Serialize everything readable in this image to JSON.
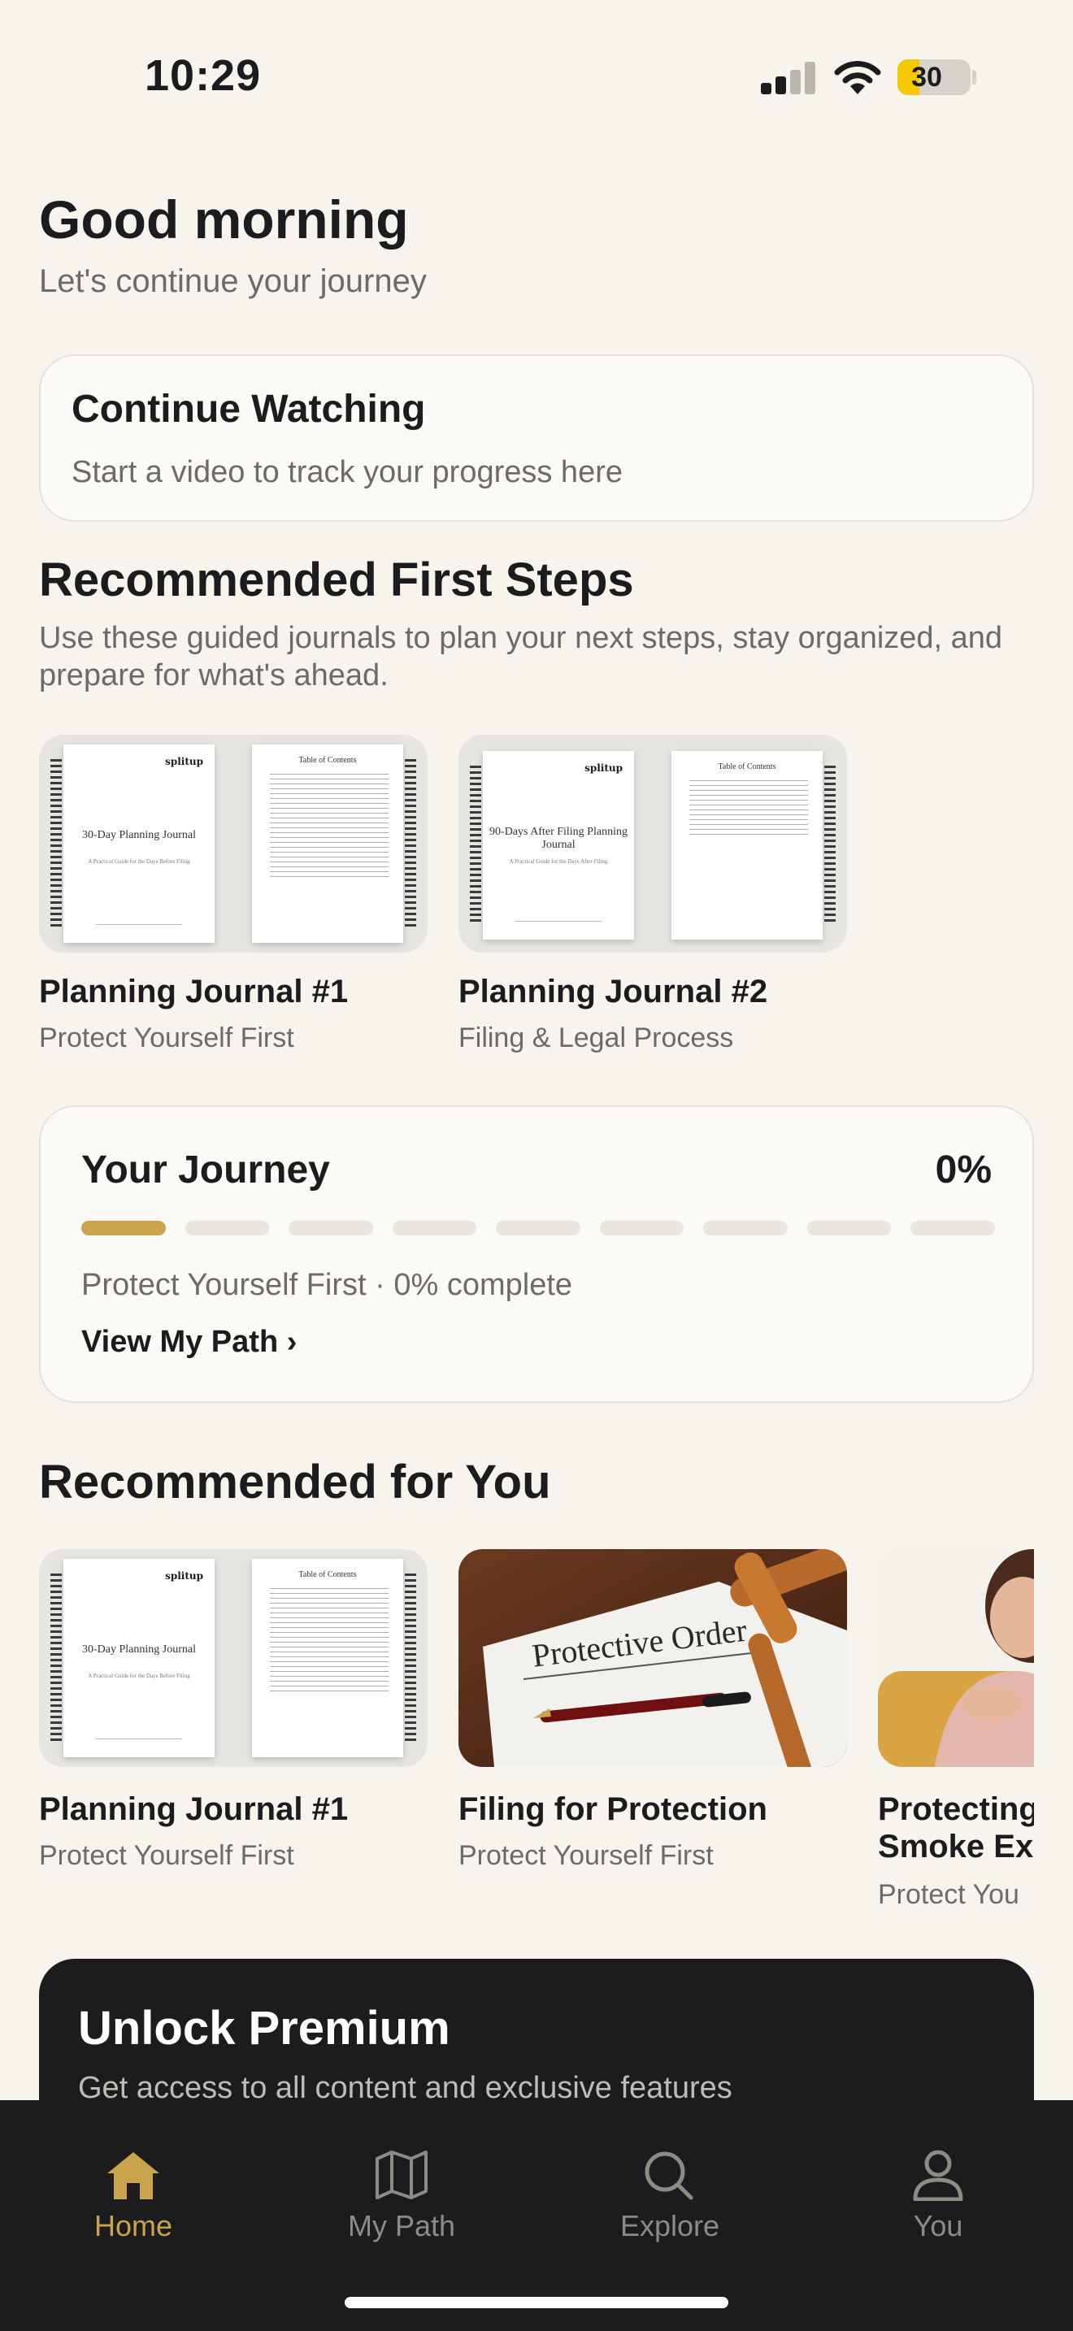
{
  "status_bar": {
    "time": "10:29",
    "battery": "30",
    "battery_level": 0.3
  },
  "greeting": {
    "title": "Good morning",
    "subtitle": "Let's continue your journey"
  },
  "continue_watching": {
    "title": "Continue Watching",
    "subtitle": "Start a video to track your progress here"
  },
  "first_steps": {
    "title": "Recommended First Steps",
    "description": "Use these guided journals to plan your next steps, stay organized, and prepare for what's ahead.",
    "items": [
      {
        "title": "Planning Journal #1",
        "subtitle": "Protect Yourself First",
        "cover_title": "30-Day Planning Journal",
        "cover_sub": "A Practical Guide for the Days Before Filing",
        "brand": "splitup",
        "toc_title": "Table of Contents"
      },
      {
        "title": "Planning Journal #2",
        "subtitle": "Filing & Legal Process",
        "cover_title": "90-Days After Filing Planning Journal",
        "cover_sub": "A Practical Guide for the Days After Filing",
        "brand": "splitup",
        "toc_title": "Table of Contents"
      }
    ]
  },
  "journey": {
    "title": "Your Journey",
    "percent": "0%",
    "progress": 0,
    "segments": 9,
    "status": "Protect Yourself First · 0% complete",
    "link": "View My Path ›",
    "accent": "#c9a44c"
  },
  "recommended": {
    "title": "Recommended for You",
    "items": [
      {
        "title": "Planning Journal #1",
        "subtitle": "Protect Yourself First",
        "cover_title": "30-Day Planning Journal",
        "cover_sub": "A Practical Guide for the Days Before Filing",
        "brand": "splitup",
        "toc_title": "Table of Contents"
      },
      {
        "title": "Filing for Protection",
        "subtitle": "Protect Yourself First",
        "image_text": "Protective Order"
      },
      {
        "title": "Protecting",
        "title_line2": "Smoke Exp",
        "subtitle": "Protect You"
      }
    ]
  },
  "premium": {
    "title": "Unlock Premium",
    "subtitle": "Get access to all content and exclusive features"
  },
  "tabbar": {
    "tabs": [
      {
        "label": "Home",
        "icon": "home-icon",
        "active": true
      },
      {
        "label": "My Path",
        "icon": "map-icon",
        "active": false
      },
      {
        "label": "Explore",
        "icon": "search-icon",
        "active": false
      },
      {
        "label": "You",
        "icon": "person-icon",
        "active": false
      }
    ]
  },
  "colors": {
    "background": "#f7f4ee",
    "accent": "#c9a44c",
    "dark": "#1c1c1e",
    "muted": "#6e6b66"
  }
}
